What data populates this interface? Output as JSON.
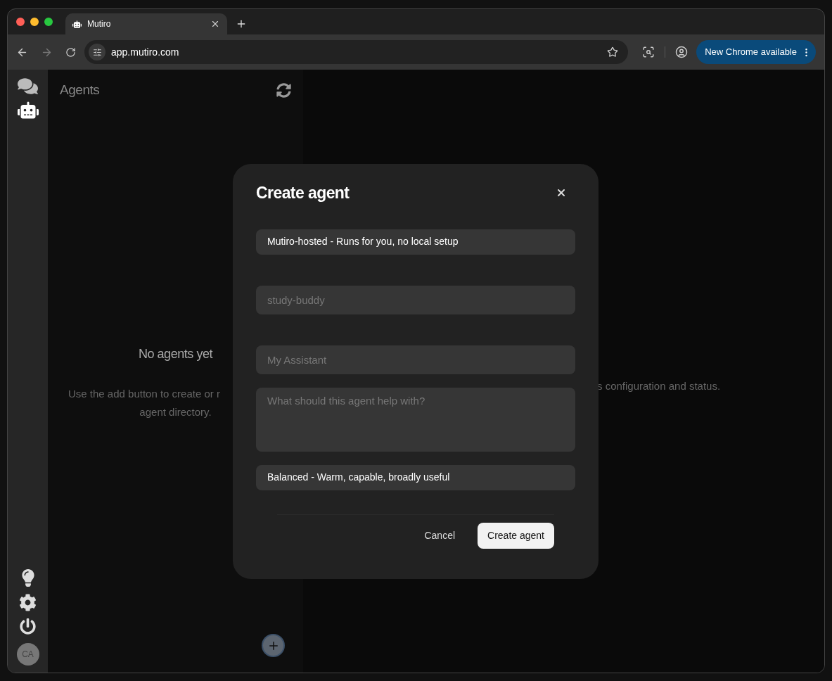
{
  "browser": {
    "tab": {
      "title": "Mutiro"
    },
    "url": "app.mutiro.com",
    "update_button": "New Chrome available"
  },
  "rail": {
    "avatar": "CA"
  },
  "agents_panel": {
    "title": "Agents",
    "empty_title": "No agents yet",
    "empty_lines": [
      "Use the add button to create or r",
      "agent directory."
    ]
  },
  "detail": {
    "fragments": [
      "s configuration and status."
    ]
  },
  "dialog": {
    "title": "Create agent",
    "fields": [
      {
        "kind": "select",
        "value": "Mutiro-hosted - Runs for you, no local setup"
      },
      {
        "kind": "input",
        "placeholder": "study-buddy"
      },
      {
        "kind": "input",
        "placeholder": "My Assistant"
      },
      {
        "kind": "textarea",
        "placeholder": "What should this agent help with?"
      },
      {
        "kind": "select",
        "value": "Balanced - Warm, capable, broadly useful"
      }
    ],
    "cancel": "Cancel",
    "submit": "Create agent"
  }
}
